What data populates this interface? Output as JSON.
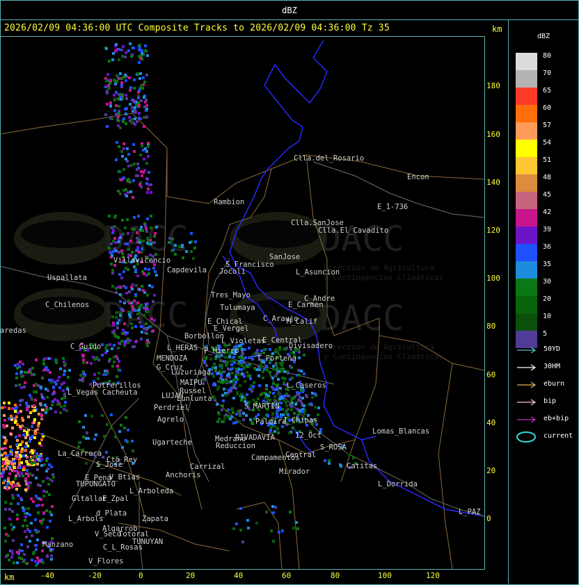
{
  "header": {
    "title": "dBZ"
  },
  "subtitle": "2026/02/09 04:36:00 UTC Composite Tracks to 2026/02/09 04:36:00 Tz 35",
  "axis_unit": "km",
  "y_ticks": [
    "180",
    "160",
    "140",
    "120",
    "100",
    "80",
    "60",
    "40",
    "20",
    "0"
  ],
  "x_ticks": [
    "-40",
    "-20",
    "0",
    "20",
    "40",
    "60",
    "80",
    "100",
    "120"
  ],
  "legend": {
    "title": "dBZ",
    "scale": [
      {
        "label": "80",
        "color": "#dcdcdc"
      },
      {
        "label": "70",
        "color": "#b4b4b4"
      },
      {
        "label": "65",
        "color": "#ff3c28"
      },
      {
        "label": "60",
        "color": "#ff6e0a"
      },
      {
        "label": "57",
        "color": "#ff9b5a"
      },
      {
        "label": "54",
        "color": "#ffff00"
      },
      {
        "label": "51",
        "color": "#ffc832"
      },
      {
        "label": "48",
        "color": "#dc8c3c"
      },
      {
        "label": "45",
        "color": "#c8647d"
      },
      {
        "label": "42",
        "color": "#c8148c"
      },
      {
        "label": "39",
        "color": "#6e14c8"
      },
      {
        "label": "36",
        "color": "#1e50ff"
      },
      {
        "label": "35",
        "color": "#1e8cdc"
      },
      {
        "label": "30",
        "color": "#0a7814"
      },
      {
        "label": "20",
        "color": "#0a640a"
      },
      {
        "label": "10",
        "color": "#0a500a"
      },
      {
        "label": "5",
        "color": "#503c96"
      }
    ]
  },
  "tracks": [
    {
      "label": "50YD",
      "color": "#50c8c8"
    },
    {
      "label": "30HM",
      "color": "#ffffff"
    },
    {
      "label": "eburn",
      "color": "#e6b45a"
    },
    {
      "label": "bip",
      "color": "#ffc8c8"
    },
    {
      "label": "eb+bip",
      "color": "#c832c8"
    },
    {
      "label": "current",
      "color": "#32dcdc"
    }
  ],
  "watermark": {
    "name": "DACC",
    "line1": "Dirección de Agricultura",
    "line2": "y Contingencias Climáticas"
  },
  "places": [
    {
      "name": "Clla.del_Rosario"
    },
    {
      "name": "Encon"
    },
    {
      "name": "Rambion"
    },
    {
      "name": "E_1-736"
    },
    {
      "name": "Clla.SanJose"
    },
    {
      "name": "Clla.El_Cavadito"
    },
    {
      "name": "Villavicencio"
    },
    {
      "name": "Capdevila"
    },
    {
      "name": "S_Francisco"
    },
    {
      "name": "SanJose"
    },
    {
      "name": "Jocoli"
    },
    {
      "name": "L_Asuncion"
    },
    {
      "name": "Uspallata"
    },
    {
      "name": "Tres_Mayo"
    },
    {
      "name": "C_Andre"
    },
    {
      "name": "Tulumaya"
    },
    {
      "name": "E_Carmen"
    },
    {
      "name": "C_Chilenos"
    },
    {
      "name": "C_Araujo"
    },
    {
      "name": "E_Chical"
    },
    {
      "name": "M_Calif"
    },
    {
      "name": "E_Vergel"
    },
    {
      "name": "aredas"
    },
    {
      "name": "Borbollon"
    },
    {
      "name": "E_Central"
    },
    {
      "name": "L_Violetas"
    },
    {
      "name": "Divisadero"
    },
    {
      "name": "C_Guido"
    },
    {
      "name": "L_HERAS"
    },
    {
      "name": "P_Hierro"
    },
    {
      "name": "MENDOZA"
    },
    {
      "name": "T_Porteña"
    },
    {
      "name": "G_Cruz"
    },
    {
      "name": "Luzuriaga"
    },
    {
      "name": "MAIPU"
    },
    {
      "name": "Russel"
    },
    {
      "name": "Potrerillos"
    },
    {
      "name": "L_Vegas"
    },
    {
      "name": "Cacheuta"
    },
    {
      "name": "LUJAN"
    },
    {
      "name": "Lunlunta"
    },
    {
      "name": "Perdriel"
    },
    {
      "name": "Agrelo"
    },
    {
      "name": "S_MARTIN"
    },
    {
      "name": "L_Caseros"
    },
    {
      "name": "Palmira"
    },
    {
      "name": "Ugarteche"
    },
    {
      "name": "J_Chipas"
    },
    {
      "name": "12_Oct"
    },
    {
      "name": "S_ROSA"
    },
    {
      "name": "Lomas_Blancas"
    },
    {
      "name": "Medrano"
    },
    {
      "name": "RIVADAVIA"
    },
    {
      "name": "La_Carrera"
    },
    {
      "name": "Cto_Rey"
    },
    {
      "name": "Reduccion"
    },
    {
      "name": "Campamentos"
    },
    {
      "name": "S_Jose"
    },
    {
      "name": "Carrizal"
    },
    {
      "name": "Central"
    },
    {
      "name": "Catitas"
    },
    {
      "name": "E_Pena"
    },
    {
      "name": "V_Btias"
    },
    {
      "name": "Anchoris"
    },
    {
      "name": "TUPUNGATO"
    },
    {
      "name": "Mirador"
    },
    {
      "name": "L_Dorrida"
    },
    {
      "name": "L_Arboleda"
    },
    {
      "name": "Gltallar"
    },
    {
      "name": "E_Zpal"
    },
    {
      "name": "d_Plata"
    },
    {
      "name": "L_Arbols"
    },
    {
      "name": "Zapata"
    },
    {
      "name": "L_PAZ"
    },
    {
      "name": "Algarrob"
    },
    {
      "name": "V_Seco"
    },
    {
      "name": "Totoral"
    },
    {
      "name": "TUNUYAN"
    },
    {
      "name": "Manzano"
    },
    {
      "name": "C_L_Rosas"
    },
    {
      "name": "V_Flores"
    }
  ]
}
